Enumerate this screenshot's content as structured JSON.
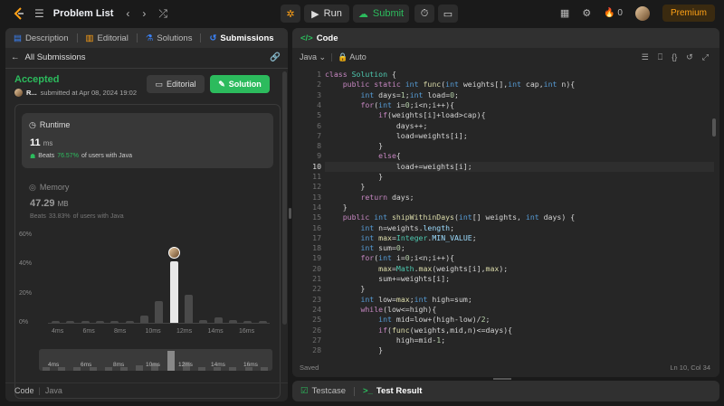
{
  "topbar": {
    "problem_list": "Problem List",
    "run": "Run",
    "submit": "Submit",
    "streak": "0",
    "premium": "Premium"
  },
  "left_tabs": [
    "Description",
    "Editorial",
    "Solutions",
    "Submissions"
  ],
  "submissions": {
    "back": "All Submissions",
    "status": "Accepted",
    "user": "R...",
    "submitted": "submitted at Apr 08, 2024 19:02",
    "editorial_btn": "Editorial",
    "solution_btn": "Solution"
  },
  "runtime": {
    "label": "Runtime",
    "value": "11",
    "unit": "ms",
    "beats_prefix": "Beats",
    "beats_pct": "76.57%",
    "beats_suffix": "of users with Java"
  },
  "memory": {
    "label": "Memory",
    "value": "47.29",
    "unit": "MB",
    "beats_prefix": "Beats",
    "beats_pct": "33.83%",
    "beats_suffix": "of users with Java"
  },
  "chart_data": {
    "type": "bar",
    "yticks": [
      "60%",
      "40%",
      "20%",
      "0%"
    ],
    "ylim": [
      0,
      60
    ],
    "xticks": [
      "4ms",
      "6ms",
      "8ms",
      "10ms",
      "12ms",
      "14ms",
      "16ms"
    ],
    "values": [
      1.5,
      1.5,
      1.5,
      1.5,
      1.5,
      1.5,
      5,
      15,
      42,
      19,
      2,
      4,
      2,
      1,
      1
    ],
    "highlight_index": 8,
    "mini_values": [
      1,
      1,
      1,
      1,
      1,
      1,
      2,
      3,
      10,
      4,
      1,
      1,
      1,
      1,
      1
    ]
  },
  "footer_left": {
    "code": "Code",
    "lang": "Java"
  },
  "code_panel": {
    "title": "Code",
    "lang": "Java",
    "auto": "Auto",
    "saved": "Saved",
    "cursor": "Ln 10, Col 34"
  },
  "bottom_tabs": {
    "testcase": "Testcase",
    "result": "Test Result"
  },
  "code_lines": [
    "class Solution {",
    "    public static int func(int weights[],int cap,int n){",
    "        int days=1;int load=0;",
    "        for(int i=0;i<n;i++){",
    "            if(weights[i]+load>cap){",
    "                days++;",
    "                load=weights[i];",
    "            }",
    "            else{",
    "                load+=weights[i];",
    "            }",
    "        }",
    "        return days;",
    "    }",
    "    public int shipWithinDays(int[] weights, int days) {",
    "        int n=weights.length;",
    "        int max=Integer.MIN_VALUE;",
    "        int sum=0;",
    "        for(int i=0;i<n;i++){",
    "            max=Math.max(weights[i],max);",
    "            sum+=weights[i];",
    "        }",
    "        int low=max;int high=sum;",
    "        while(low<=high){",
    "            int mid=low+(high-low)/2;",
    "            if(func(weights,mid,n)<=days){",
    "                high=mid-1;",
    "            }"
  ]
}
